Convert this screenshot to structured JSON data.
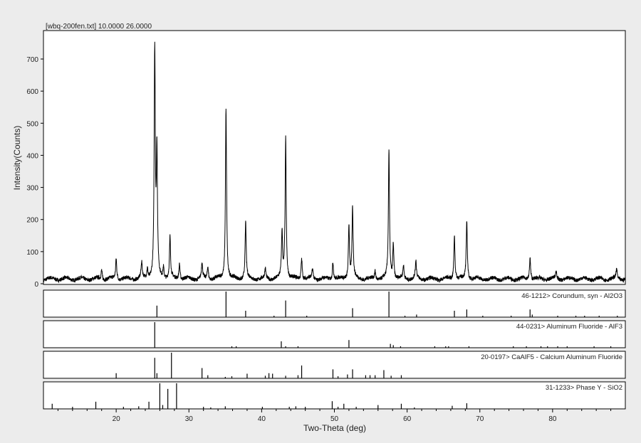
{
  "chart_data": {
    "type": "line",
    "title": "[wbq-200fen.txt] 10.0000 26.0000",
    "xlabel": "Two-Theta (deg)",
    "ylabel": "Intensity(Counts)",
    "xlim": [
      10,
      90
    ],
    "ylim": [
      0,
      780
    ],
    "xticks": [
      20,
      30,
      40,
      50,
      60,
      70,
      80
    ],
    "yticks": [
      0,
      100,
      200,
      300,
      400,
      500,
      600,
      700
    ],
    "grid": false,
    "baseline": 15,
    "peaks": [
      {
        "x": 18.0,
        "y": 30
      },
      {
        "x": 20.0,
        "y": 65
      },
      {
        "x": 23.5,
        "y": 50
      },
      {
        "x": 24.3,
        "y": 30
      },
      {
        "x": 25.3,
        "y": 705
      },
      {
        "x": 25.6,
        "y": 385
      },
      {
        "x": 26.5,
        "y": 35
      },
      {
        "x": 27.4,
        "y": 130
      },
      {
        "x": 28.7,
        "y": 50
      },
      {
        "x": 31.8,
        "y": 50
      },
      {
        "x": 32.6,
        "y": 40
      },
      {
        "x": 35.1,
        "y": 535
      },
      {
        "x": 37.8,
        "y": 178
      },
      {
        "x": 40.5,
        "y": 30
      },
      {
        "x": 42.8,
        "y": 145
      },
      {
        "x": 43.3,
        "y": 440
      },
      {
        "x": 45.5,
        "y": 65
      },
      {
        "x": 47.0,
        "y": 30
      },
      {
        "x": 49.8,
        "y": 55
      },
      {
        "x": 52.0,
        "y": 170
      },
      {
        "x": 52.5,
        "y": 222
      },
      {
        "x": 55.6,
        "y": 25
      },
      {
        "x": 57.5,
        "y": 400
      },
      {
        "x": 58.1,
        "y": 110
      },
      {
        "x": 59.5,
        "y": 40
      },
      {
        "x": 61.2,
        "y": 55
      },
      {
        "x": 66.5,
        "y": 140
      },
      {
        "x": 68.2,
        "y": 182
      },
      {
        "x": 76.9,
        "y": 70
      },
      {
        "x": 80.5,
        "y": 25
      },
      {
        "x": 88.8,
        "y": 30
      }
    ],
    "reference_patterns": [
      {
        "label": "46-1212> Corundum, syn - Al2O3",
        "sticks": [
          [
            25.6,
            45
          ],
          [
            35.1,
            100
          ],
          [
            37.8,
            25
          ],
          [
            41.7,
            5
          ],
          [
            43.3,
            65
          ],
          [
            46.2,
            5
          ],
          [
            52.5,
            35
          ],
          [
            57.5,
            100
          ],
          [
            59.7,
            5
          ],
          [
            61.3,
            10
          ],
          [
            66.5,
            25
          ],
          [
            68.2,
            30
          ],
          [
            70.4,
            5
          ],
          [
            74.3,
            3
          ],
          [
            76.9,
            30
          ],
          [
            77.2,
            10
          ],
          [
            80.7,
            3
          ],
          [
            83.2,
            3
          ],
          [
            84.4,
            5
          ],
          [
            86.4,
            3
          ],
          [
            88.9,
            5
          ]
        ]
      },
      {
        "label": "44-0231> Aluminum Fluoride - AlF3",
        "sticks": [
          [
            25.3,
            100
          ],
          [
            35.9,
            5
          ],
          [
            36.5,
            5
          ],
          [
            42.7,
            25
          ],
          [
            43.3,
            5
          ],
          [
            45.0,
            5
          ],
          [
            52.0,
            30
          ],
          [
            57.7,
            15
          ],
          [
            58.1,
            10
          ],
          [
            59.1,
            5
          ],
          [
            63.8,
            3
          ],
          [
            65.3,
            3
          ],
          [
            65.7,
            3
          ],
          [
            68.5,
            3
          ],
          [
            74.6,
            5
          ],
          [
            76.4,
            3
          ],
          [
            78.4,
            3
          ],
          [
            79.3,
            3
          ],
          [
            80.7,
            5
          ],
          [
            82.0,
            3
          ],
          [
            85.7,
            3
          ],
          [
            88.0,
            3
          ]
        ]
      },
      {
        "label": "20-0197> CaAlF5 - Calcium Aluminum Fluoride",
        "sticks": [
          [
            20.0,
            20
          ],
          [
            25.3,
            80
          ],
          [
            25.6,
            20
          ],
          [
            27.6,
            100
          ],
          [
            31.8,
            40
          ],
          [
            32.6,
            12
          ],
          [
            35.0,
            5
          ],
          [
            35.9,
            8
          ],
          [
            38.0,
            18
          ],
          [
            40.5,
            10
          ],
          [
            41.0,
            20
          ],
          [
            41.5,
            18
          ],
          [
            43.3,
            10
          ],
          [
            45.0,
            12
          ],
          [
            45.5,
            50
          ],
          [
            49.8,
            35
          ],
          [
            50.5,
            8
          ],
          [
            51.8,
            15
          ],
          [
            52.5,
            35
          ],
          [
            54.3,
            12
          ],
          [
            54.9,
            12
          ],
          [
            55.6,
            12
          ],
          [
            56.8,
            32
          ],
          [
            57.8,
            10
          ],
          [
            59.2,
            12
          ]
        ]
      },
      {
        "label": "31-1233> Phase Y - SiO2",
        "sticks": [
          [
            11.2,
            20
          ],
          [
            14.0,
            8
          ],
          [
            17.2,
            28
          ],
          [
            21.0,
            8
          ],
          [
            23.1,
            10
          ],
          [
            24.5,
            28
          ],
          [
            26.0,
            100
          ],
          [
            26.4,
            15
          ],
          [
            27.1,
            78
          ],
          [
            28.3,
            100
          ],
          [
            32.0,
            8
          ],
          [
            33.0,
            5
          ],
          [
            35.0,
            10
          ],
          [
            40.1,
            8
          ],
          [
            43.8,
            8
          ],
          [
            44.7,
            10
          ],
          [
            46.0,
            8
          ],
          [
            49.7,
            30
          ],
          [
            50.5,
            8
          ],
          [
            51.3,
            20
          ],
          [
            53.0,
            8
          ],
          [
            56.0,
            15
          ],
          [
            59.2,
            20
          ],
          [
            61.0,
            5
          ],
          [
            66.2,
            12
          ],
          [
            68.2,
            22
          ]
        ]
      }
    ]
  }
}
